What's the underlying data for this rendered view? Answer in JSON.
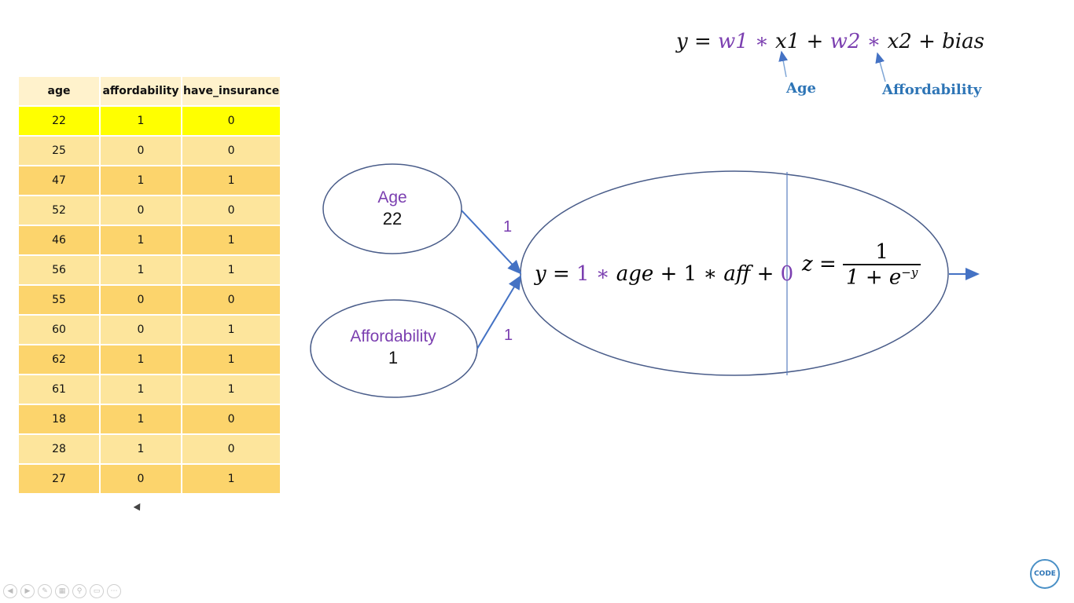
{
  "table": {
    "headers": [
      "age",
      "affordability",
      "have_insurance"
    ],
    "rows": [
      [
        "22",
        "1",
        "0"
      ],
      [
        "25",
        "0",
        "0"
      ],
      [
        "47",
        "1",
        "1"
      ],
      [
        "52",
        "0",
        "0"
      ],
      [
        "46",
        "1",
        "1"
      ],
      [
        "56",
        "1",
        "1"
      ],
      [
        "55",
        "0",
        "0"
      ],
      [
        "60",
        "0",
        "1"
      ],
      [
        "62",
        "1",
        "1"
      ],
      [
        "61",
        "1",
        "1"
      ],
      [
        "18",
        "1",
        "0"
      ],
      [
        "28",
        "1",
        "0"
      ],
      [
        "27",
        "0",
        "1"
      ]
    ]
  },
  "formula": {
    "y": "y",
    "eq": "=",
    "w1": "w1",
    "star": "∗",
    "x1": "x1",
    "plus": "+",
    "w2": "w2",
    "x2": "x2",
    "bias": "bias",
    "age_label": "Age",
    "afford_label": "Affordability"
  },
  "inputs": {
    "age_title": "Age",
    "age_value": "22",
    "aff_title": "Affordability",
    "aff_value": "1"
  },
  "weights": {
    "w_age": "1",
    "w_aff": "1"
  },
  "neuron": {
    "linear": {
      "y": "y",
      "eq": "=",
      "w1": "1",
      "star": "∗",
      "age": "age",
      "plus": "+",
      "w2": "1",
      "aff": "aff",
      "bias": "0"
    },
    "sigmoid": {
      "z": "z",
      "eq": "=",
      "num": "1",
      "den": "1 + e",
      "exp": "−y"
    }
  },
  "logo": "CODE",
  "colors": {
    "highlight": "#ffff00",
    "row_light": "#fde59c",
    "row_dark": "#fcd46c",
    "accent_purple": "#7b3fb0",
    "accent_blue": "#2e75b6",
    "arrow_blue": "#4472c4"
  }
}
